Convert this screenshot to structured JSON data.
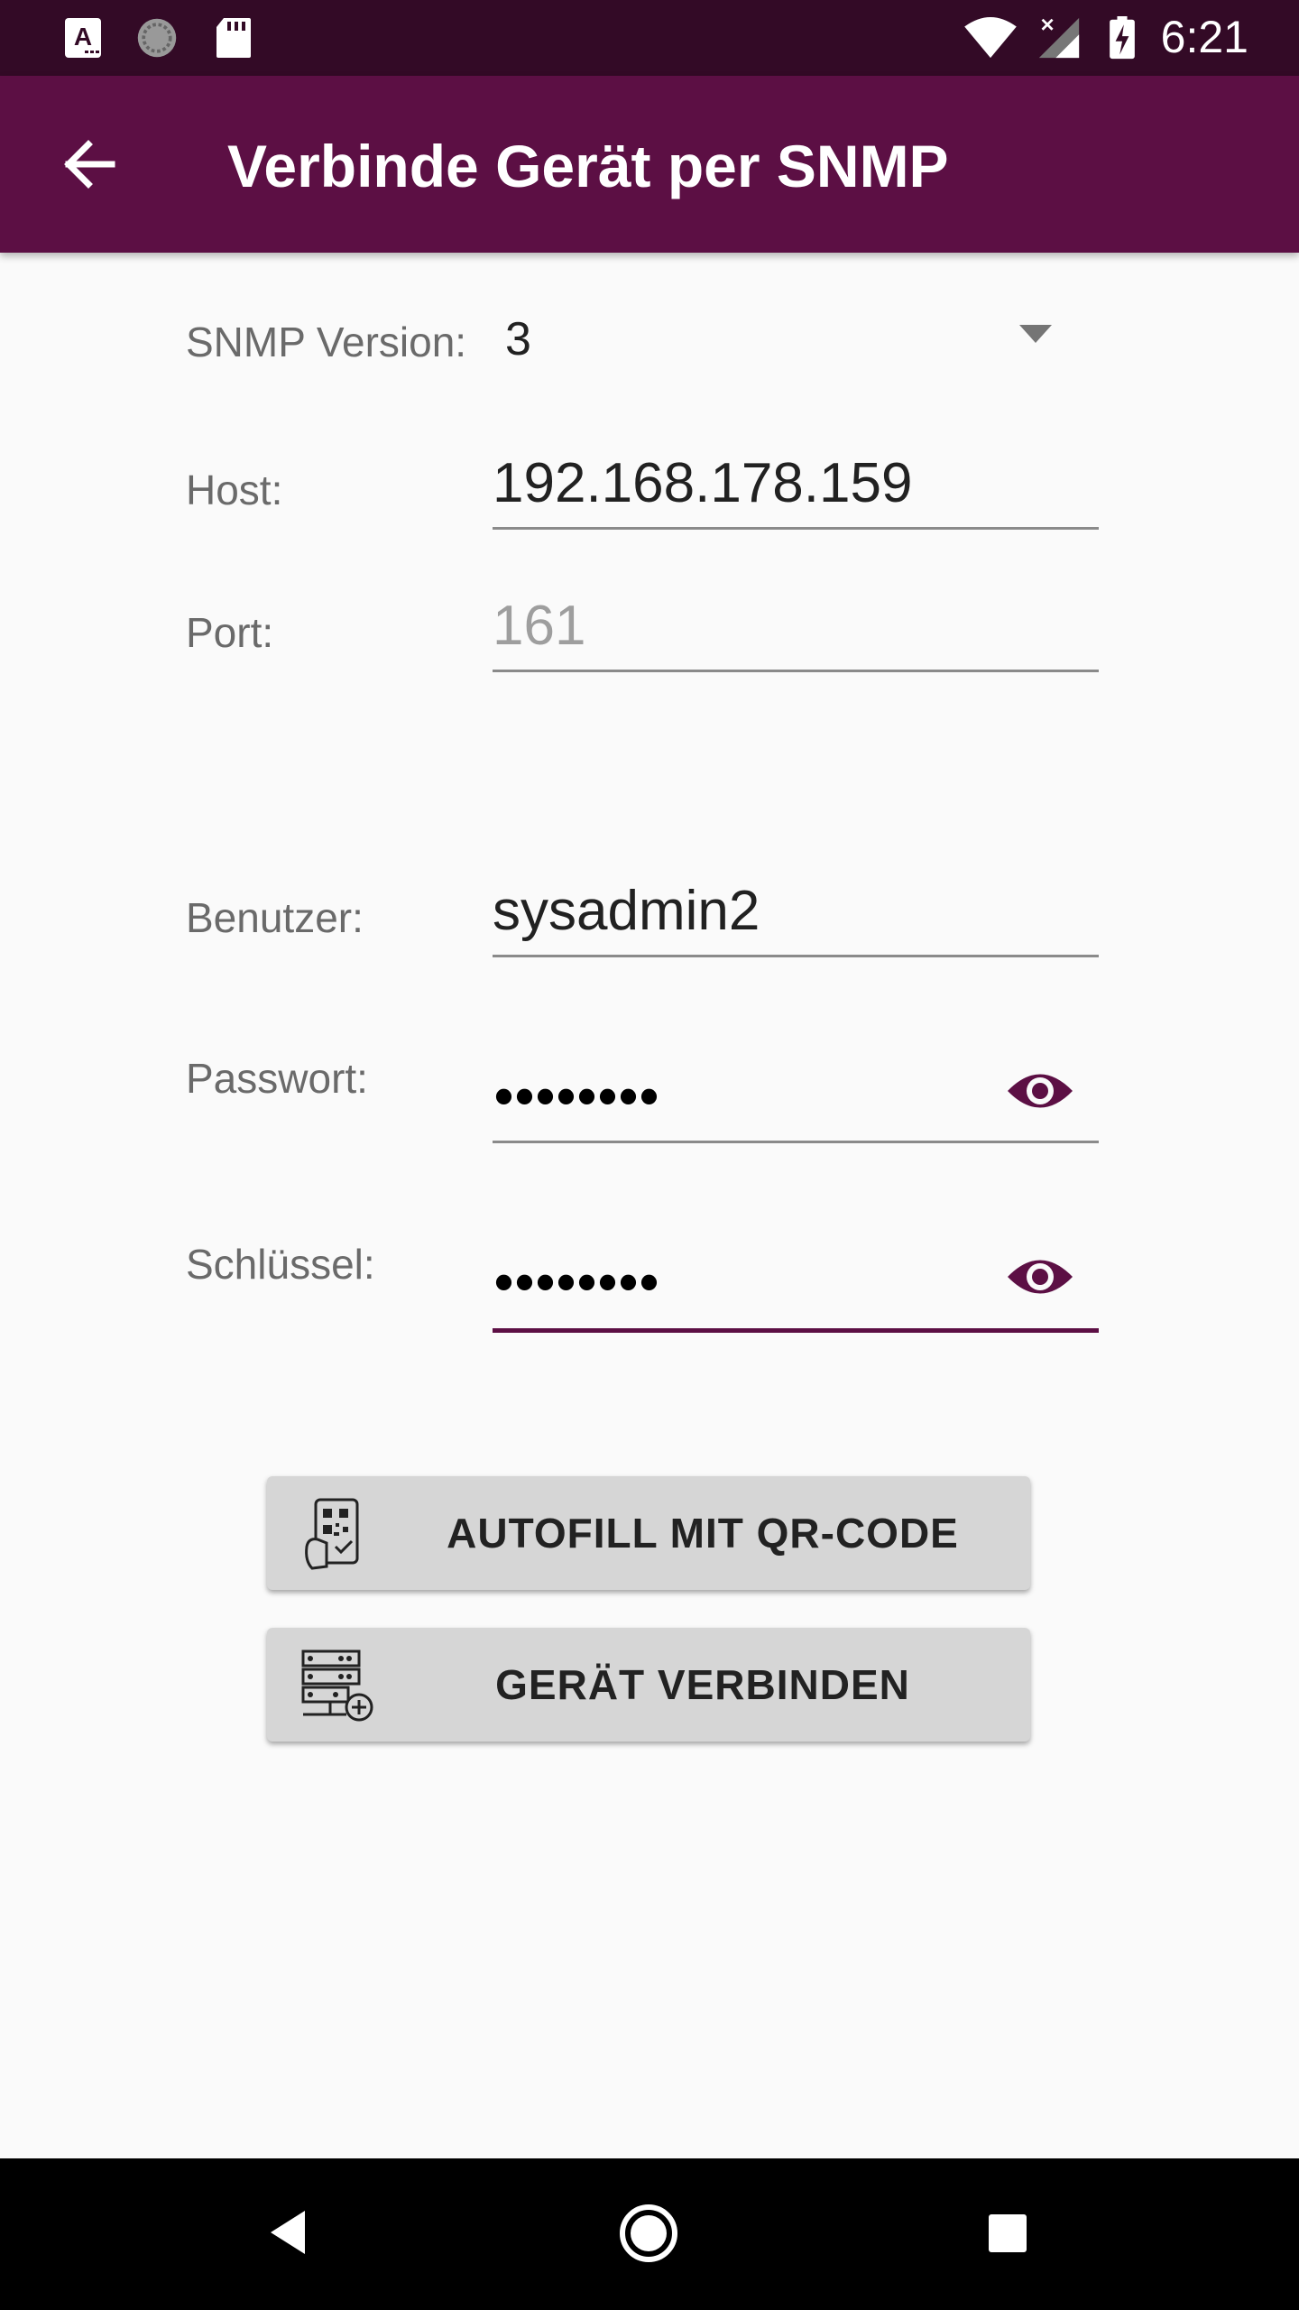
{
  "status_bar": {
    "time": "6:21"
  },
  "app_bar": {
    "title": "Verbinde Gerät per SNMP"
  },
  "form": {
    "snmp_version_label": "SNMP Version:",
    "snmp_version_value": "3",
    "host_label": "Host:",
    "host_value": "192.168.178.159",
    "port_label": "Port:",
    "port_placeholder": "161",
    "user_label": "Benutzer:",
    "user_value": "sysadmin2",
    "password_label": "Passwort:",
    "password_masked": "••••••••",
    "key_label": "Schlüssel:",
    "key_masked": "••••••••"
  },
  "buttons": {
    "autofill_label": "AUTOFILL MIT QR-CODE",
    "connect_label": "GERÄT VERBINDEN"
  },
  "colors": {
    "primary": "#5c0f44",
    "status_bar": "#330a26",
    "button_bg": "#d6d6d6"
  },
  "icons": [
    "text-icon",
    "sync-icon",
    "sd-card-icon",
    "wifi-icon",
    "no-signal-icon",
    "battery-charging-icon",
    "back-arrow-icon",
    "dropdown-arrow-icon",
    "eye-icon",
    "qr-phone-icon",
    "server-add-icon",
    "nav-back-icon",
    "nav-home-icon",
    "nav-recents-icon"
  ]
}
